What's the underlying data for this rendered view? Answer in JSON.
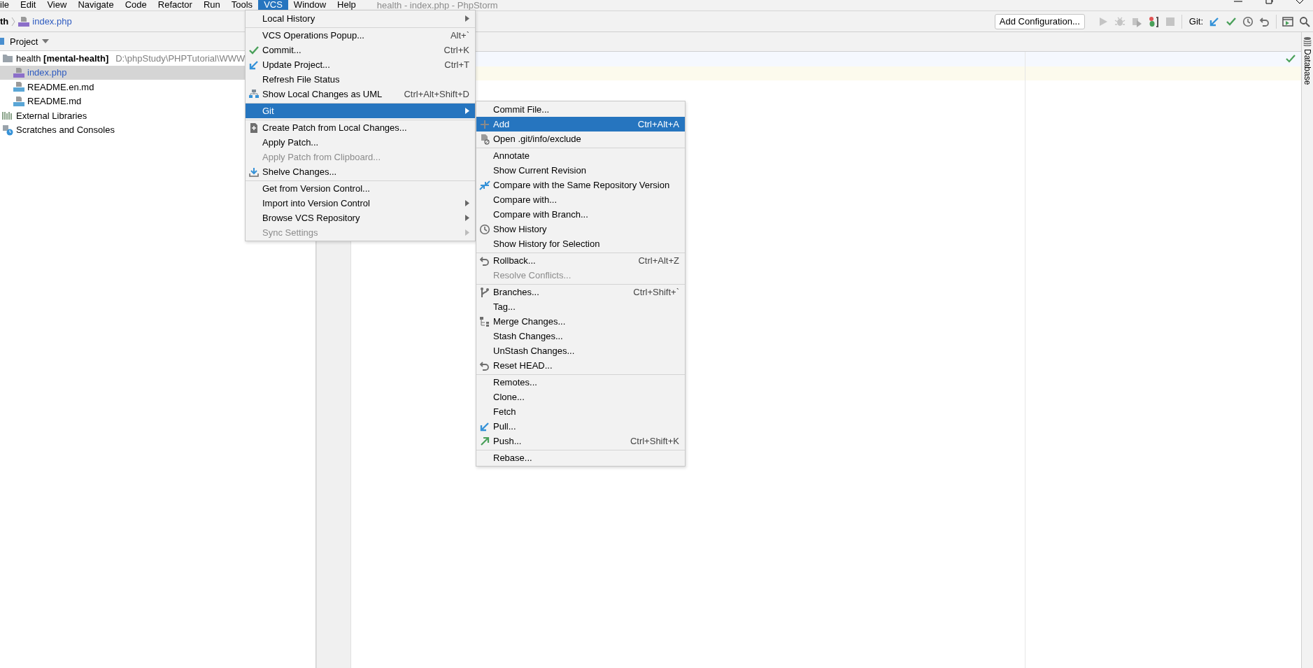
{
  "window": {
    "title": "health - index.php - PhpStorm"
  },
  "menu_bar": [
    {
      "label": "ile",
      "selected": false
    },
    {
      "label": "Edit",
      "selected": false
    },
    {
      "label": "View",
      "selected": false
    },
    {
      "label": "Navigate",
      "selected": false
    },
    {
      "label": "Code",
      "selected": false
    },
    {
      "label": "Refactor",
      "selected": false
    },
    {
      "label": "Run",
      "selected": false
    },
    {
      "label": "Tools",
      "selected": false
    },
    {
      "label": "VCS",
      "selected": true
    },
    {
      "label": "Window",
      "selected": false
    },
    {
      "label": "Help",
      "selected": false
    }
  ],
  "breadcrumb": [
    {
      "label": "th"
    },
    {
      "label": "index.php"
    }
  ],
  "toolbar": {
    "run_configuration": "Add Configuration...",
    "git_label": "Git:"
  },
  "project_panel": {
    "title": "Project",
    "tree": [
      {
        "label": "health **[mental-health]**",
        "path": "D:\\phpStudy\\PHPTutorial\\WWW",
        "kind": "folder",
        "selected": false,
        "children": [
          {
            "label": "index.php",
            "kind": "php",
            "selected": true,
            "color": "#2f5cc0"
          },
          {
            "label": "README.en.md",
            "kind": "md",
            "selected": false,
            "color": "#000000"
          },
          {
            "label": "README.md",
            "kind": "md",
            "selected": false,
            "color": "#000000"
          }
        ]
      },
      {
        "label": "External Libraries",
        "kind": "libraries",
        "selected": false
      },
      {
        "label": "Scratches and Consoles",
        "kind": "scratches",
        "selected": false
      }
    ]
  },
  "right_strip": {
    "label": "Database"
  },
  "vcs_menu": {
    "items": [
      {
        "label": "Local History",
        "has_submenu": true,
        "disabled": false,
        "selected": false,
        "separator_before": false
      },
      {
        "label": "VCS Operations Popup...",
        "shortcut": "Alt+`",
        "has_submenu": false,
        "disabled": false,
        "selected": false,
        "separator_before": true
      },
      {
        "label": "Commit...",
        "shortcut": "Ctrl+K",
        "has_submenu": false,
        "disabled": false,
        "selected": false,
        "separator_before": false
      },
      {
        "label": "Update Project...",
        "shortcut": "Ctrl+T",
        "has_submenu": false,
        "disabled": false,
        "selected": false,
        "separator_before": false
      },
      {
        "label": "Refresh File Status",
        "has_submenu": false,
        "disabled": false,
        "selected": false,
        "separator_before": false
      },
      {
        "label": "Show Local Changes as UML",
        "shortcut": "Ctrl+Alt+Shift+D",
        "has_submenu": false,
        "disabled": false,
        "selected": false,
        "separator_before": false
      },
      {
        "label": "Git",
        "has_submenu": true,
        "disabled": false,
        "selected": true,
        "separator_before": true
      },
      {
        "label": "Create Patch from Local Changes...",
        "has_submenu": false,
        "disabled": false,
        "selected": false,
        "separator_before": true
      },
      {
        "label": "Apply Patch...",
        "has_submenu": false,
        "disabled": false,
        "selected": false,
        "separator_before": false
      },
      {
        "label": "Apply Patch from Clipboard...",
        "has_submenu": false,
        "disabled": true,
        "selected": false,
        "separator_before": false
      },
      {
        "label": "Shelve Changes...",
        "has_submenu": false,
        "disabled": false,
        "selected": false,
        "separator_before": false
      },
      {
        "label": "Get from Version Control...",
        "has_submenu": false,
        "disabled": false,
        "selected": false,
        "separator_before": true
      },
      {
        "label": "Import into Version Control",
        "has_submenu": true,
        "disabled": false,
        "selected": false,
        "separator_before": false
      },
      {
        "label": "Browse VCS Repository",
        "has_submenu": true,
        "disabled": false,
        "selected": false,
        "separator_before": false
      },
      {
        "label": "Sync Settings",
        "has_submenu": true,
        "disabled": true,
        "selected": false,
        "separator_before": false
      }
    ]
  },
  "git_submenu": {
    "items": [
      {
        "label": "Commit File...",
        "disabled": false,
        "selected": false,
        "separator_before": false
      },
      {
        "label": "Add",
        "shortcut": "Ctrl+Alt+A",
        "disabled": false,
        "selected": true,
        "separator_before": false
      },
      {
        "label": "Open .git/info/exclude",
        "disabled": false,
        "selected": false,
        "separator_before": false
      },
      {
        "label": "Annotate",
        "disabled": false,
        "selected": false,
        "separator_before": true
      },
      {
        "label": "Show Current Revision",
        "disabled": false,
        "selected": false,
        "separator_before": false
      },
      {
        "label": "Compare with the Same Repository Version",
        "disabled": false,
        "selected": false,
        "separator_before": false
      },
      {
        "label": "Compare with...",
        "disabled": false,
        "selected": false,
        "separator_before": false
      },
      {
        "label": "Compare with Branch...",
        "disabled": false,
        "selected": false,
        "separator_before": false
      },
      {
        "label": "Show History",
        "disabled": false,
        "selected": false,
        "separator_before": false
      },
      {
        "label": "Show History for Selection",
        "disabled": false,
        "selected": false,
        "separator_before": false
      },
      {
        "label": "Rollback...",
        "shortcut": "Ctrl+Alt+Z",
        "disabled": false,
        "selected": false,
        "separator_before": true
      },
      {
        "label": "Resolve Conflicts...",
        "disabled": true,
        "selected": false,
        "separator_before": false
      },
      {
        "label": "Branches...",
        "shortcut": "Ctrl+Shift+`",
        "disabled": false,
        "selected": false,
        "separator_before": true
      },
      {
        "label": "Tag...",
        "disabled": false,
        "selected": false,
        "separator_before": false
      },
      {
        "label": "Merge Changes...",
        "disabled": false,
        "selected": false,
        "separator_before": false
      },
      {
        "label": "Stash Changes...",
        "disabled": false,
        "selected": false,
        "separator_before": false
      },
      {
        "label": "UnStash Changes...",
        "disabled": false,
        "selected": false,
        "separator_before": false
      },
      {
        "label": "Reset HEAD...",
        "disabled": false,
        "selected": false,
        "separator_before": false
      },
      {
        "label": "Remotes...",
        "disabled": false,
        "selected": false,
        "separator_before": true
      },
      {
        "label": "Clone...",
        "disabled": false,
        "selected": false,
        "separator_before": false
      },
      {
        "label": "Fetch",
        "disabled": false,
        "selected": false,
        "separator_before": false
      },
      {
        "label": "Pull...",
        "disabled": false,
        "selected": false,
        "separator_before": false
      },
      {
        "label": "Push...",
        "shortcut": "Ctrl+Shift+K",
        "disabled": false,
        "selected": false,
        "separator_before": false
      },
      {
        "label": "Rebase...",
        "disabled": false,
        "selected": false,
        "separator_before": true
      }
    ]
  }
}
